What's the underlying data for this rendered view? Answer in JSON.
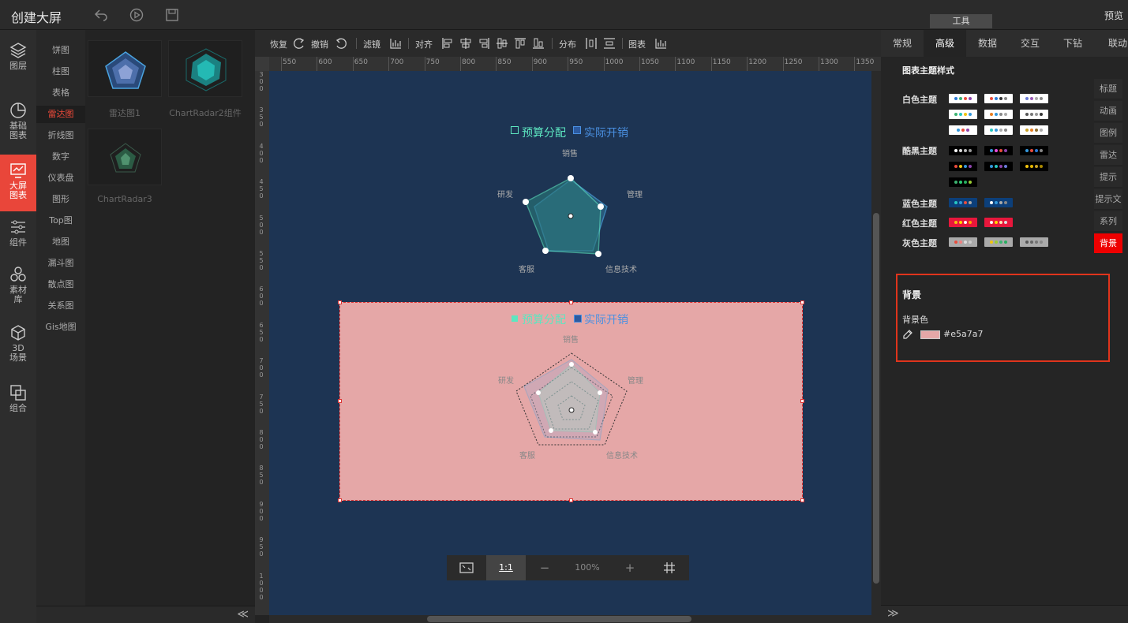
{
  "app": {
    "title": "创建大屏",
    "preview": "预览",
    "tools_tab": "工具"
  },
  "leftnav": [
    {
      "label1": "图层",
      "label2": "",
      "icon": "layers-icon"
    },
    {
      "label1": "基础",
      "label2": "图表",
      "icon": "pie-chart-icon"
    },
    {
      "label1": "大屏",
      "label2": "图表",
      "icon": "big-screen-icon"
    },
    {
      "label1": "组件",
      "label2": "",
      "icon": "sliders-icon"
    },
    {
      "label1": "素材",
      "label2": "库",
      "icon": "material-icon"
    },
    {
      "label1": "3D",
      "label2": "场景",
      "icon": "cube-icon"
    },
    {
      "label1": "组合",
      "label2": "",
      "icon": "combine-icon"
    }
  ],
  "subnav": [
    "饼图",
    "柱图",
    "表格",
    "雷达图",
    "折线图",
    "数字",
    "仪表盘",
    "图形",
    "Top图",
    "地图",
    "漏斗图",
    "散点图",
    "关系图",
    "Gis地图"
  ],
  "thumbs": [
    "雷达图1",
    "ChartRadar2组件",
    "ChartRadar3"
  ],
  "toolbar": {
    "redo": "恢复",
    "undo": "撤销",
    "filter": "滤镜",
    "align": "对齐",
    "distribute": "分布",
    "chart": "图表"
  },
  "ruler_top": [
    "550",
    "600",
    "650",
    "700",
    "750",
    "800",
    "850",
    "900",
    "950",
    "1000",
    "1050",
    "1100",
    "1150",
    "1200",
    "1250",
    "1300",
    "1350"
  ],
  "ruler_left": [
    "300",
    "350",
    "400",
    "450",
    "500",
    "550",
    "600",
    "650",
    "700",
    "750",
    "800",
    "850",
    "900",
    "950",
    "1000"
  ],
  "chart_data": [
    {
      "type": "radar",
      "legend": [
        "预算分配",
        "实际开销"
      ],
      "indicators": [
        "销售",
        "管理",
        "信息技术",
        "客服",
        "研发"
      ]
    },
    {
      "type": "radar",
      "legend": [
        "预算分配",
        "实际开销"
      ],
      "indicators": [
        "销售",
        "管理",
        "信息技术",
        "客服",
        "研发"
      ]
    }
  ],
  "zoom": {
    "ratio": "1:1",
    "minus": "−",
    "level": "100%",
    "plus": "+"
  },
  "right": {
    "tabs": [
      "常规",
      "高级",
      "数据",
      "交互",
      "下钻",
      "联动"
    ],
    "section": "图表主题样式",
    "themes": {
      "white": "白色主题",
      "dark": "酷黑主题",
      "blue": "蓝色主题",
      "red": "红色主题",
      "gray": "灰色主题"
    },
    "side_tabs": [
      "标题",
      "动画",
      "图例",
      "雷达",
      "提示",
      "提示文",
      "系列",
      "背景"
    ],
    "bg_title": "背景",
    "bg_color_label": "背景色",
    "bg_color_value": "#e5a7a7"
  },
  "colors": {
    "accent": "#e9463a",
    "canvas": "#1d3453",
    "selected_bg": "#e5a7a7"
  }
}
